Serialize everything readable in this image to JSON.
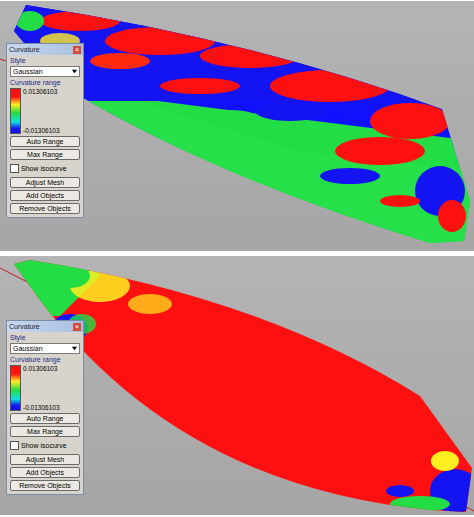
{
  "viewports": [
    {
      "kind": "mixed",
      "panel": {
        "window": {
          "title": "Curvature",
          "close": "×"
        },
        "style_label": "Style",
        "style_select": {
          "value": "Gaussian"
        },
        "range_label": "Curvature range",
        "range_max": "0.01306103",
        "range_min": "-0.01306103",
        "range_buttons": [
          "Auto Range",
          "Max Range"
        ],
        "checkbox": {
          "label": "Show isocurve",
          "checked": false
        },
        "buttons": [
          "Adjust Mesh",
          "Add Objects",
          "Remove Objects"
        ]
      }
    },
    {
      "kind": "smooth",
      "panel": {
        "window": {
          "title": "Curvature",
          "close": "×"
        },
        "style_label": "Style",
        "style_select": {
          "value": "Gaussian"
        },
        "range_label": "Curvature range",
        "range_max": "0.01306103",
        "range_min": "-0.01306103",
        "range_buttons": [
          "Auto Range",
          "Max Range"
        ],
        "checkbox": {
          "label": "Show isocurve",
          "checked": false
        },
        "buttons": [
          "Adjust Mesh",
          "Add Objects",
          "Remove Objects"
        ]
      }
    }
  ]
}
